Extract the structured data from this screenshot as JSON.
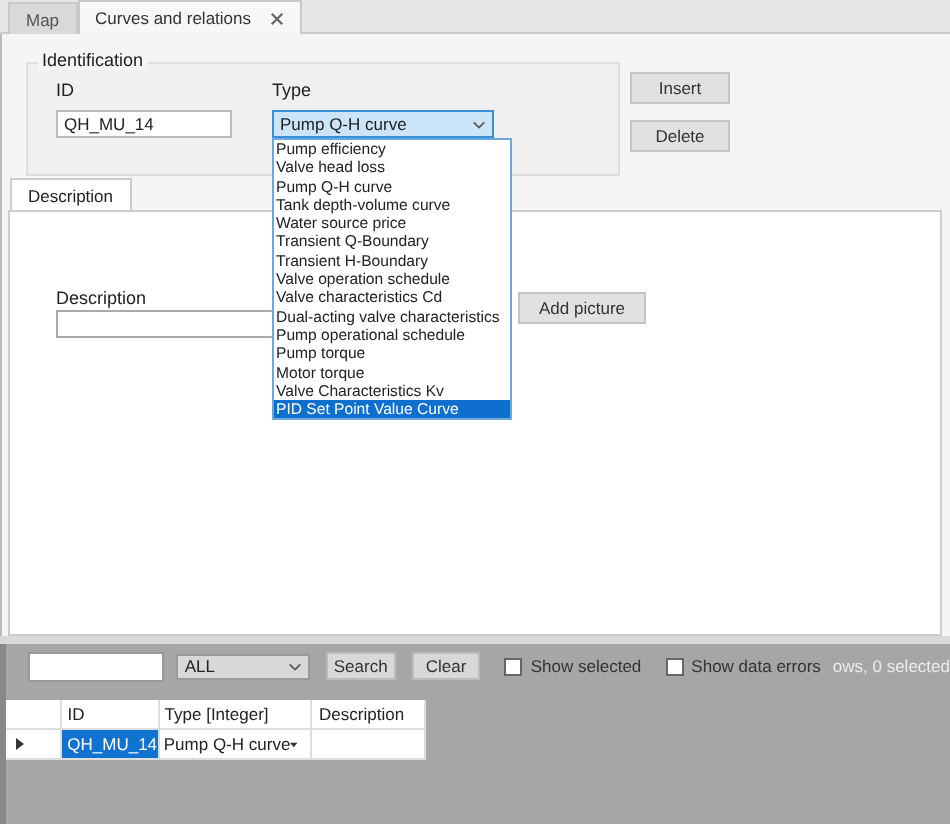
{
  "tabs": [
    {
      "label": "Map",
      "selected": false,
      "closable": false
    },
    {
      "label": "Curves and relations",
      "selected": true,
      "closable": true
    }
  ],
  "identification": {
    "title": "Identification",
    "id_label": "ID",
    "id_value": "QH_MU_14",
    "type_label": "Type",
    "type_value": "Pump Q-H curve",
    "type_expanded": true,
    "type_options": [
      {
        "label": "Pump efficiency",
        "selected": false
      },
      {
        "label": "Valve head loss",
        "selected": false
      },
      {
        "label": "Pump Q-H curve",
        "selected": false
      },
      {
        "label": "Tank depth-volume curve",
        "selected": false
      },
      {
        "label": "Water source price",
        "selected": false
      },
      {
        "label": "Transient Q-Boundary",
        "selected": false
      },
      {
        "label": "Transient H-Boundary",
        "selected": false
      },
      {
        "label": "Valve operation schedule",
        "selected": false
      },
      {
        "label": "Valve characteristics Cd",
        "selected": false
      },
      {
        "label": "Dual-acting valve characteristics",
        "selected": false
      },
      {
        "label": "Pump operational schedule",
        "selected": false
      },
      {
        "label": "Pump torque",
        "selected": false
      },
      {
        "label": "Motor torque",
        "selected": false
      },
      {
        "label": "Valve Characteristics Kv",
        "selected": false
      },
      {
        "label": "PID Set Point Value Curve",
        "selected": true
      }
    ]
  },
  "buttons": [
    "Insert",
    "Delete"
  ],
  "detail_tabs": [
    {
      "label": "Description",
      "selected": true
    }
  ],
  "description": {
    "label": "Description",
    "add_picture_button": "Add picture"
  },
  "filter_bar": {
    "category": "ALL",
    "buttons": [
      "Search",
      "Clear"
    ],
    "checkboxes": [
      {
        "label": "Show selected",
        "checked": false
      },
      {
        "label": "Show data errors",
        "checked": false
      }
    ],
    "status": "ows, 0 selected"
  },
  "grid": {
    "columns": [
      "ID",
      "Type [Integer]",
      "Description"
    ],
    "rows": [
      {
        "current": true,
        "selected": true,
        "id": "QH_MU_14",
        "type": "Pump Q-H curve"
      }
    ]
  }
}
